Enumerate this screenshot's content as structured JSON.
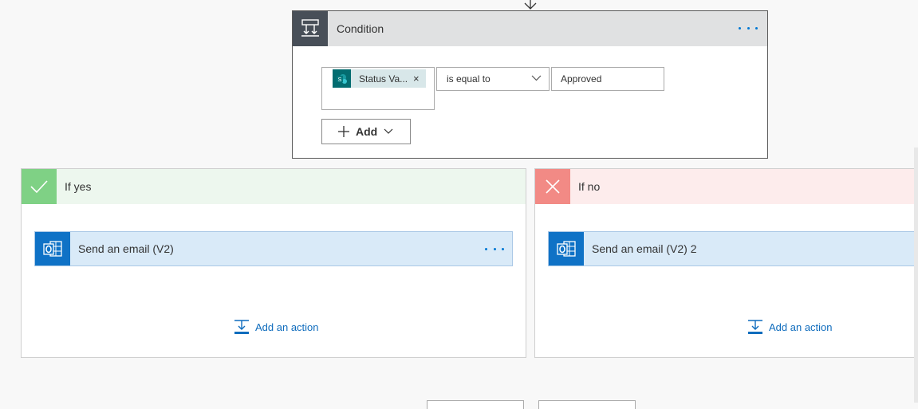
{
  "condition": {
    "title": "Condition",
    "token_label": "Status Va...",
    "token_remove": "×",
    "operator": "is equal to",
    "value": "Approved",
    "add_label": "Add"
  },
  "branches": {
    "yes": {
      "title": "If yes",
      "action_title": "Send an email (V2)",
      "add_action_label": "Add an action"
    },
    "no": {
      "title": "If no",
      "action_title": "Send an email (V2) 2",
      "add_action_label": "Add an action"
    }
  },
  "colors": {
    "condition_header": "#e0e1e2",
    "condition_icon_bg": "#484f58",
    "yes_accent": "#7fd185",
    "no_accent": "#f28a85",
    "action_bg": "#d9eaf8",
    "outlook_blue": "#0f72c6",
    "link_blue": "#0f6cbd"
  },
  "icons": {
    "condition": "condition-icon",
    "sharepoint": "sharepoint-icon",
    "yes": "checkmark-icon",
    "no": "close-icon",
    "outlook": "outlook-icon",
    "add_action": "add-action-icon",
    "more": "more-options-icon"
  }
}
